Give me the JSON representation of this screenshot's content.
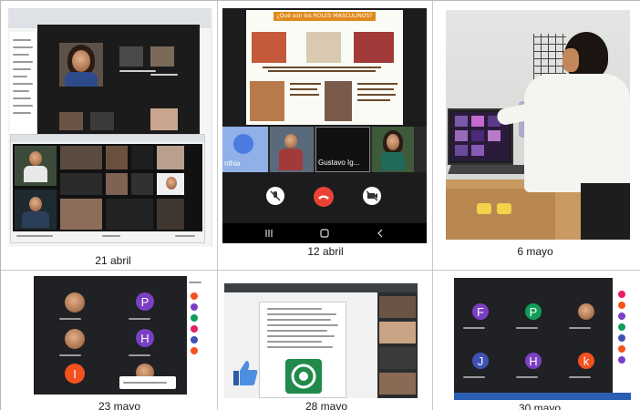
{
  "captions": {
    "p1": "21 abril",
    "p2": "12 abril",
    "p3": "6 mayo",
    "p4": "23 mayo",
    "p5": "28 mayo",
    "p6": "30 mayo"
  },
  "slide": {
    "title": "¿Qué son los ROLES MASCULINOS?"
  },
  "call_names": {
    "n1": "nthia",
    "n2": "Gustavo Ig..."
  },
  "avatars": {
    "p4_a": "P",
    "p4_b": "H",
    "p4_c": "I",
    "p6_a": "F",
    "p6_b": "P",
    "p6_c": "J",
    "p6_d": "H",
    "p6_e": "k"
  },
  "colors": {
    "meet_bg": "#202124",
    "avatar_purple": "#7b3fc4",
    "avatar_orange": "#f4511e",
    "avatar_green": "#0f9d58",
    "avatar_blue": "#3f51b5",
    "end_call_red": "#ea4335"
  },
  "icons": [
    "mic-off-icon",
    "end-call-icon",
    "camera-off-icon",
    "back-nav-icon",
    "home-nav-icon",
    "recents-nav-icon"
  ]
}
